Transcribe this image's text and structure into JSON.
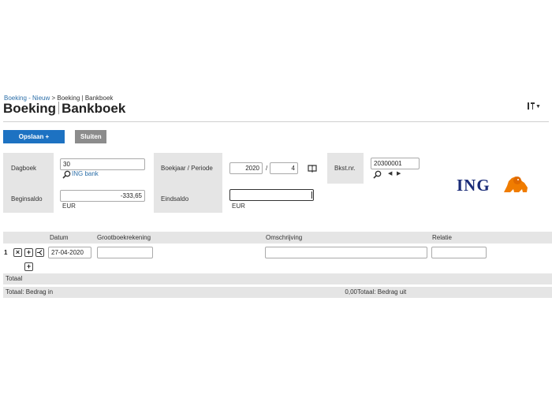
{
  "breadcrumb": {
    "link": "Boeking - Nieuw",
    "separator": ">",
    "current": "Boeking | Bankboek"
  },
  "title": {
    "part1": "Boeking",
    "part2": "Bankboek"
  },
  "toolbar": {
    "save_new_label": "Opslaan + Nieuw",
    "close_label": "Sluiten"
  },
  "form": {
    "dagboek_label": "Dagboek",
    "dagboek_value": "30",
    "dagboek_link": "ING bank",
    "beginsaldo_label": "Beginsaldo",
    "beginsaldo_value": "-333,65",
    "beginsaldo_currency": "EUR",
    "boekjaar_label": "Boekjaar / Periode",
    "boekjaar_value": "2020",
    "periode_separator": "/",
    "periode_value": "4",
    "eindsaldo_label": "Eindsaldo",
    "eindsaldo_value": "",
    "eindsaldo_currency": "EUR",
    "bkst_label": "Bkst.nr.",
    "bkst_value": "20300001"
  },
  "bank_logo": {
    "text": "ING",
    "brand_color": "#1b2c78",
    "lion_color": "#f07c00"
  },
  "grid": {
    "columns": [
      "Datum",
      "Grootboekrekening",
      "Omschrijving",
      "Relatie"
    ],
    "rows": [
      {
        "number": "1",
        "datum": "27-04-2020",
        "grootboekrekening": "",
        "omschrijving": "",
        "relatie": ""
      }
    ],
    "totaal_label": "Totaal",
    "bedrag_in_label": "Totaal: Bedrag in",
    "bedrag_in_value": "0,00",
    "bedrag_uit_label": "Totaal: Bedrag uit"
  },
  "colors": {
    "accent": "#1d72c2",
    "secondary_button": "#8c8c8c",
    "panel": "#e5e5e5"
  }
}
